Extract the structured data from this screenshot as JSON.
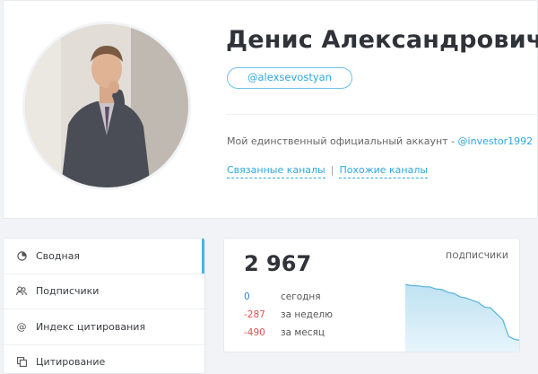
{
  "profile": {
    "name": "Денис Александрович",
    "username": "@alexsevostyan",
    "description_prefix": "Мой единственный официальный аккаунт - ",
    "description_link": "@investor1992",
    "links": {
      "related": "Связанные каналы",
      "separator": "|",
      "similar": "Похожие каналы"
    }
  },
  "menu": {
    "items": [
      {
        "label": "Сводная",
        "icon": "summary-icon",
        "active": true
      },
      {
        "label": "Подписчики",
        "icon": "subscribers-icon"
      },
      {
        "label": "Индекс цитирования",
        "icon": "at-icon"
      },
      {
        "label": "Цитирование",
        "icon": "quote-icon"
      }
    ]
  },
  "stats": {
    "total": "2 967",
    "label": "ПОДПИСЧИКИ",
    "rows": [
      {
        "value": "0",
        "caption": "сегодня",
        "color": "#3a7bd5"
      },
      {
        "value": "-287",
        "caption": "за неделю",
        "color": "#e0524f"
      },
      {
        "value": "-490",
        "caption": "за месяц",
        "color": "#e0524f"
      }
    ]
  },
  "chart_data": {
    "type": "area",
    "title": "",
    "xlabel": "",
    "ylabel": "",
    "values": [
      3457,
      3450,
      3448,
      3440,
      3438,
      3420,
      3415,
      3390,
      3380,
      3350,
      3340,
      3320,
      3300,
      3260,
      3254,
      3200,
      3150,
      3000,
      2975,
      2967
    ],
    "ylim": [
      2900,
      3500
    ]
  },
  "colors": {
    "accent": "#2ea7df",
    "negative": "#e0524f",
    "chart_line": "#5fb6dc"
  }
}
